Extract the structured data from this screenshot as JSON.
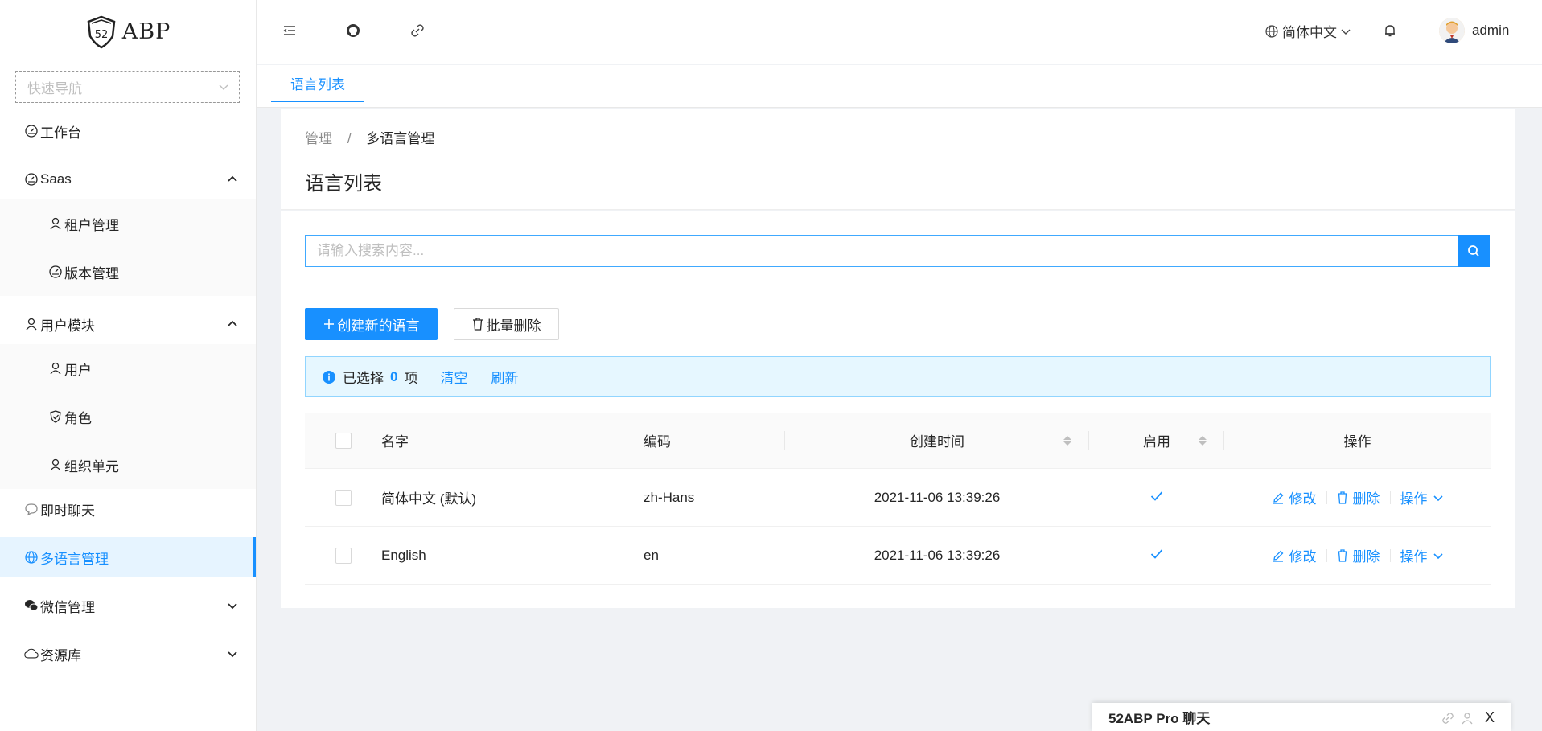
{
  "app": {
    "logo_text": "ABP",
    "logo_badge": "52"
  },
  "sidebar": {
    "quick_nav_placeholder": "快速导航",
    "items": [
      {
        "label": "工作台",
        "icon": "dashboard-icon"
      },
      {
        "label": "Saas",
        "icon": "dashboard-icon",
        "expanded": true,
        "children": [
          {
            "label": "租户管理",
            "icon": "team-icon"
          },
          {
            "label": "版本管理",
            "icon": "dashboard-icon"
          }
        ]
      },
      {
        "label": "用户模块",
        "icon": "user-icon",
        "expanded": true,
        "children": [
          {
            "label": "用户",
            "icon": "user-icon"
          },
          {
            "label": "角色",
            "icon": "safety-icon"
          },
          {
            "label": "组织单元",
            "icon": "team-icon"
          }
        ]
      },
      {
        "label": "即时聊天",
        "icon": "message-icon"
      },
      {
        "label": "多语言管理",
        "icon": "global-icon",
        "active": true
      },
      {
        "label": "微信管理",
        "icon": "wechat-icon",
        "expanded": false
      },
      {
        "label": "资源库",
        "icon": "cloud-icon",
        "expanded": false
      }
    ]
  },
  "header": {
    "language": "简体中文",
    "username": "admin"
  },
  "tabs": [
    {
      "label": "语言列表",
      "active": true
    }
  ],
  "breadcrumb": {
    "parent": "管理",
    "separator": "/",
    "current": "多语言管理"
  },
  "page": {
    "title": "语言列表"
  },
  "search": {
    "placeholder": "请输入搜索内容..."
  },
  "toolbar": {
    "create_label": "创建新的语言",
    "batch_delete_label": "批量删除"
  },
  "selection": {
    "prefix": "已选择",
    "count": "0",
    "suffix": "项",
    "clear": "清空",
    "refresh": "刷新"
  },
  "table": {
    "columns": {
      "name": "名字",
      "code": "编码",
      "created": "创建时间",
      "enabled": "启用",
      "actions": "操作"
    },
    "action_labels": {
      "edit": "修改",
      "delete": "删除",
      "more": "操作"
    },
    "rows": [
      {
        "name": "简体中文 (默认)",
        "code": "zh-Hans",
        "created": "2021-11-06 13:39:26",
        "enabled": true
      },
      {
        "name": "English",
        "code": "en",
        "created": "2021-11-06 13:39:26",
        "enabled": true
      }
    ]
  },
  "chat": {
    "title": "52ABP Pro 聊天",
    "close": "X"
  },
  "colors": {
    "primary": "#1890ff",
    "alert_bg": "#e6f7ff",
    "active_bg": "#e6f4ff"
  }
}
